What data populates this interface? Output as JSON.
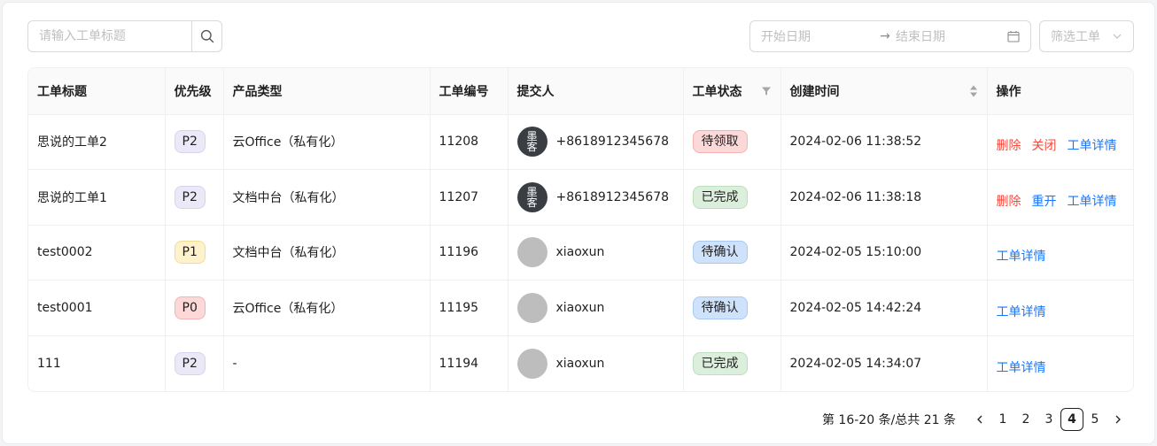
{
  "search": {
    "placeholder": "请输入工单标题"
  },
  "date_range": {
    "start_placeholder": "开始日期",
    "arrow": "→",
    "end_placeholder": "结束日期"
  },
  "filter": {
    "label": "筛选工单"
  },
  "table": {
    "headers": {
      "title": "工单标题",
      "priority": "优先级",
      "product": "产品类型",
      "number": "工单编号",
      "submitter": "提交人",
      "status": "工单状态",
      "created": "创建时间",
      "actions": "操作"
    },
    "rows": [
      {
        "title": "思说的工单2",
        "priority": "P2",
        "product": "云Office（私有化）",
        "number": "11208",
        "submitter": "+8618912345678",
        "avatar": "logo",
        "avatar_text": "墨客",
        "status": "待领取",
        "status_kind": "pending",
        "created": "2024-02-06 11:38:52",
        "actions": [
          {
            "label": "删除",
            "kind": "red"
          },
          {
            "label": "关闭",
            "kind": "red"
          },
          {
            "label": "工单详情",
            "kind": "blue"
          }
        ]
      },
      {
        "title": "思说的工单1",
        "priority": "P2",
        "product": "文档中台（私有化）",
        "number": "11207",
        "submitter": "+8618912345678",
        "avatar": "logo",
        "avatar_text": "墨客",
        "status": "已完成",
        "status_kind": "done",
        "created": "2024-02-06 11:38:18",
        "actions": [
          {
            "label": "删除",
            "kind": "red"
          },
          {
            "label": "重开",
            "kind": "blue"
          },
          {
            "label": "工单详情",
            "kind": "blue"
          }
        ]
      },
      {
        "title": "test0002",
        "priority": "P1",
        "product": "文档中台（私有化）",
        "number": "11196",
        "submitter": "xiaoxun",
        "avatar": "gray",
        "status": "待确认",
        "status_kind": "confirm",
        "created": "2024-02-05 15:10:00",
        "actions": [
          {
            "label": "工单详情",
            "kind": "blue"
          }
        ]
      },
      {
        "title": "test0001",
        "priority": "P0",
        "product": "云Office（私有化）",
        "number": "11195",
        "submitter": "xiaoxun",
        "avatar": "gray",
        "status": "待确认",
        "status_kind": "confirm",
        "created": "2024-02-05 14:42:24",
        "actions": [
          {
            "label": "工单详情",
            "kind": "blue"
          }
        ]
      },
      {
        "title": "111",
        "priority": "P2",
        "product": "-",
        "number": "11194",
        "submitter": "xiaoxun",
        "avatar": "gray",
        "status": "已完成",
        "status_kind": "done",
        "created": "2024-02-05 14:34:07",
        "actions": [
          {
            "label": "工单详情",
            "kind": "blue"
          }
        ]
      }
    ]
  },
  "pagination": {
    "summary": "第 16-20 条/总共 21 条",
    "pages": [
      "1",
      "2",
      "3",
      "4",
      "5"
    ],
    "current": "4"
  },
  "colors": {
    "red_link": "#f5483b",
    "blue_link": "#1677ff",
    "priority": {
      "P0": {
        "bg": "#fdd8d8",
        "border": "#f3b3b3"
      },
      "P1": {
        "bg": "#fdf2cc",
        "border": "#f2dc92"
      },
      "P2": {
        "bg": "#ebe9f7",
        "border": "#d6d3ee"
      }
    },
    "status": {
      "pending": {
        "bg": "#fdd8d8",
        "border": "#f3b3b3"
      },
      "done": {
        "bg": "#dcefdc",
        "border": "#bddfbd"
      },
      "confirm": {
        "bg": "#cfe2fb",
        "border": "#a9c9f2"
      }
    }
  },
  "icons": {
    "search": "search-icon",
    "calendar": "calendar-icon",
    "chevron": "chevron-down-icon",
    "filter": "filter-icon",
    "sort": "sort-icon",
    "prev": "chevron-left-icon",
    "next": "chevron-right-icon"
  }
}
